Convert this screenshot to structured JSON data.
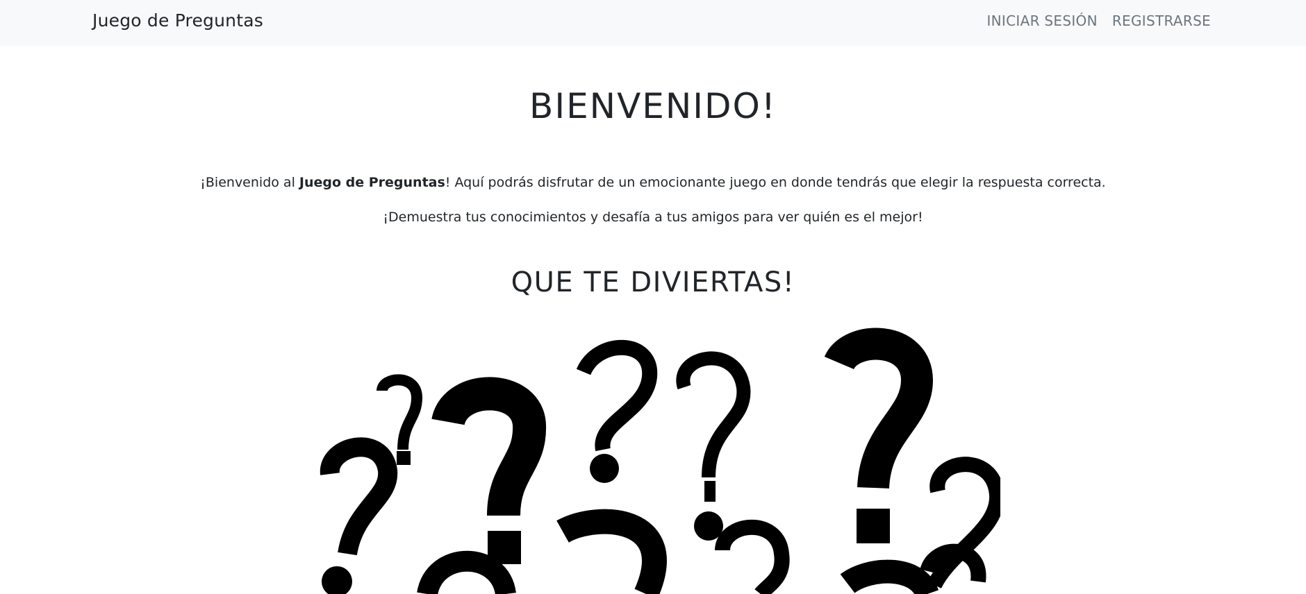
{
  "navbar": {
    "brand": "Juego de Preguntas",
    "links": [
      {
        "label": "INICIAR SESIÓN"
      },
      {
        "label": "REGISTRARSE"
      }
    ]
  },
  "main": {
    "title": "BIENVENIDO!",
    "intro_prefix": "¡Bienvenido al ",
    "intro_bold": "Juego de Preguntas",
    "intro_suffix": "! Aquí podrás disfrutar de un emocionante juego en donde tendrás que elegir la respuesta correcta.",
    "intro_line2": "¡Demuestra tus conocimientos y desafía a tus amigos para ver quién es el mejor!",
    "subtitle": "QUE TE DIVIERTAS!",
    "image": {
      "icon": "question-marks-illustration",
      "color": "#000000"
    }
  }
}
